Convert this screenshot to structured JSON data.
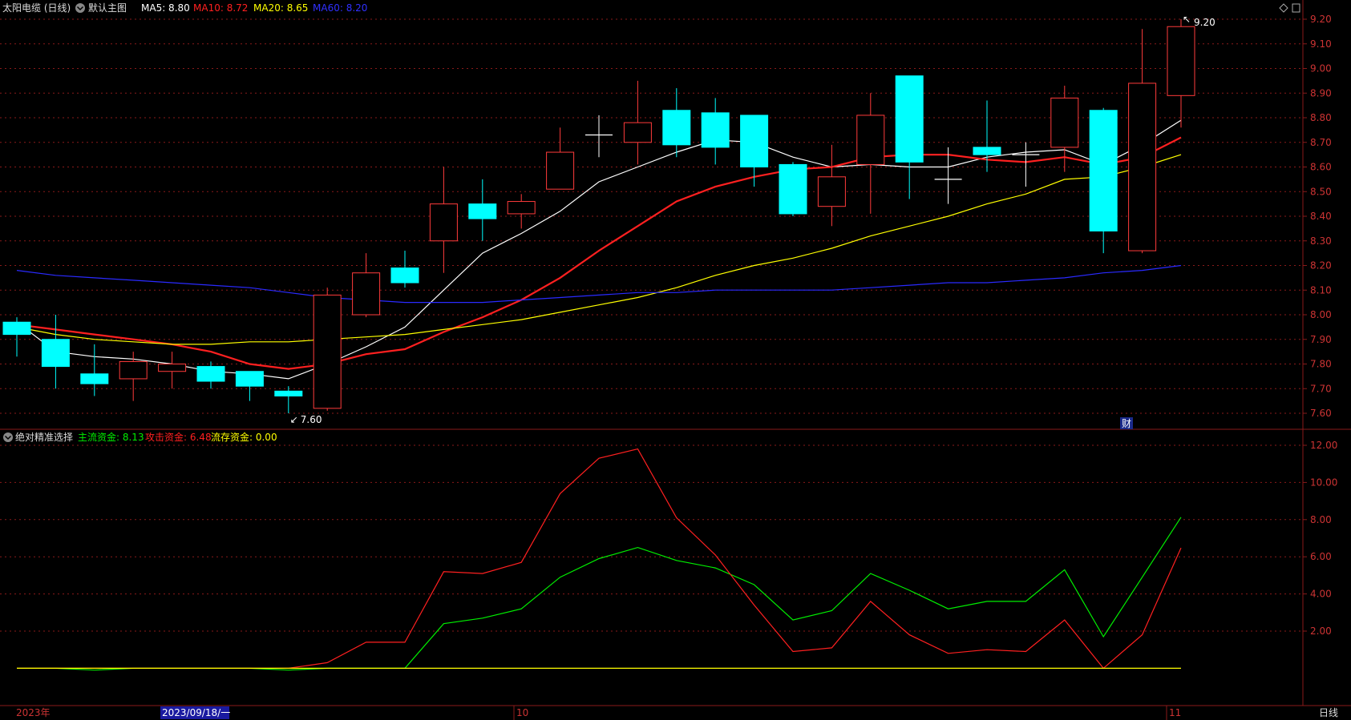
{
  "header": {
    "stock_title": "太阳电缆 (日线)",
    "indicator_dropdown": "默认主图",
    "ma5_label": "MA5: 8.80",
    "ma10_label": "MA10: 8.72",
    "ma20_label": "MA20: 8.65",
    "ma60_label": "MA60: 8.20"
  },
  "lower_header": {
    "indicator_name": "绝对精准选择",
    "main_fund_label": "主流资金: 8.13",
    "attack_fund_label": "攻击资金: 6.48",
    "flow_fund_label": "流存资金: 0.00"
  },
  "annotations": {
    "high_marker": "9.20",
    "low_marker": "7.60",
    "finance_badge": "财"
  },
  "bottom_bar": {
    "year_label": "2023年",
    "cursor_date": "2023/09/18/一",
    "month_oct": "10",
    "month_nov": "11",
    "period_label": "日线"
  },
  "colors": {
    "up": "#ff3b3b",
    "down": "#00ffff",
    "ma5": "#ffffff",
    "ma10": "#ff2020",
    "ma20": "#ffff00",
    "ma60": "#2a2aff",
    "main_fund": "#00ee00",
    "attack_fund": "#ff2020",
    "flow_fund": "#ffff00",
    "grid": "#8a1a1a"
  },
  "chart_data": [
    {
      "type": "candlestick",
      "ylim": [
        7.55,
        9.25
      ],
      "yticks": [
        "9.20",
        "9.10",
        "9.00",
        "8.90",
        "8.80",
        "8.70",
        "8.60",
        "8.50",
        "8.40",
        "8.30",
        "8.20",
        "8.10",
        "8.00",
        "7.90",
        "7.80",
        "7.70",
        "7.60"
      ],
      "candles": [
        {
          "o": 7.97,
          "c": 7.92,
          "h": 7.99,
          "l": 7.83
        },
        {
          "o": 7.9,
          "c": 7.79,
          "h": 8.0,
          "l": 7.7
        },
        {
          "o": 7.76,
          "c": 7.72,
          "h": 7.88,
          "l": 7.67
        },
        {
          "o": 7.74,
          "c": 7.81,
          "h": 7.85,
          "l": 7.65
        },
        {
          "o": 7.77,
          "c": 7.8,
          "h": 7.85,
          "l": 7.7
        },
        {
          "o": 7.79,
          "c": 7.73,
          "h": 7.81,
          "l": 7.7
        },
        {
          "o": 7.77,
          "c": 7.71,
          "h": 7.77,
          "l": 7.65
        },
        {
          "o": 7.69,
          "c": 7.67,
          "h": 7.71,
          "l": 7.6
        },
        {
          "o": 7.62,
          "c": 8.08,
          "h": 8.11,
          "l": 7.61
        },
        {
          "o": 8.0,
          "c": 8.17,
          "h": 8.25,
          "l": 7.99
        },
        {
          "o": 8.19,
          "c": 8.13,
          "h": 8.26,
          "l": 8.11
        },
        {
          "o": 8.3,
          "c": 8.45,
          "h": 8.6,
          "l": 8.17
        },
        {
          "o": 8.45,
          "c": 8.39,
          "h": 8.55,
          "l": 8.3
        },
        {
          "o": 8.41,
          "c": 8.46,
          "h": 8.49,
          "l": 8.35
        },
        {
          "o": 8.51,
          "c": 8.66,
          "h": 8.76,
          "l": 8.51
        },
        {
          "o": 8.73,
          "c": 8.73,
          "h": 8.81,
          "l": 8.64
        },
        {
          "o": 8.7,
          "c": 8.78,
          "h": 8.95,
          "l": 8.61
        },
        {
          "o": 8.83,
          "c": 8.69,
          "h": 8.92,
          "l": 8.64
        },
        {
          "o": 8.82,
          "c": 8.68,
          "h": 8.88,
          "l": 8.61
        },
        {
          "o": 8.81,
          "c": 8.6,
          "h": 8.81,
          "l": 8.52
        },
        {
          "o": 8.61,
          "c": 8.41,
          "h": 8.62,
          "l": 8.4
        },
        {
          "o": 8.44,
          "c": 8.56,
          "h": 8.69,
          "l": 8.36
        },
        {
          "o": 8.61,
          "c": 8.81,
          "h": 8.9,
          "l": 8.41
        },
        {
          "o": 8.97,
          "c": 8.62,
          "h": 8.97,
          "l": 8.47
        },
        {
          "o": 8.55,
          "c": 8.55,
          "h": 8.68,
          "l": 8.45
        },
        {
          "o": 8.68,
          "c": 8.65,
          "h": 8.87,
          "l": 8.58
        },
        {
          "o": 8.65,
          "c": 8.65,
          "h": 8.7,
          "l": 8.52
        },
        {
          "o": 8.68,
          "c": 8.88,
          "h": 8.93,
          "l": 8.58
        },
        {
          "o": 8.83,
          "c": 8.34,
          "h": 8.84,
          "l": 8.25
        },
        {
          "o": 8.26,
          "c": 8.94,
          "h": 9.16,
          "l": 8.25
        },
        {
          "o": 8.89,
          "c": 9.17,
          "h": 9.2,
          "l": 8.76
        }
      ],
      "series": [
        {
          "name": "MA5",
          "values": [
            7.97,
            7.85,
            7.83,
            7.82,
            7.8,
            7.77,
            7.76,
            7.74,
            7.8,
            7.87,
            7.95,
            8.1,
            8.25,
            8.33,
            8.42,
            8.54,
            8.6,
            8.66,
            8.71,
            8.7,
            8.64,
            8.6,
            8.61,
            8.6,
            8.6,
            8.64,
            8.66,
            8.67,
            8.61,
            8.69,
            8.79
          ]
        },
        {
          "name": "MA10",
          "values": [
            7.96,
            7.94,
            7.92,
            7.9,
            7.88,
            7.85,
            7.8,
            7.78,
            7.8,
            7.84,
            7.86,
            7.93,
            7.99,
            8.06,
            8.15,
            8.26,
            8.36,
            8.46,
            8.52,
            8.56,
            8.59,
            8.6,
            8.64,
            8.65,
            8.65,
            8.63,
            8.62,
            8.64,
            8.61,
            8.64,
            8.72
          ]
        },
        {
          "name": "MA20",
          "values": [
            7.95,
            7.92,
            7.9,
            7.89,
            7.88,
            7.88,
            7.89,
            7.89,
            7.9,
            7.91,
            7.92,
            7.94,
            7.96,
            7.98,
            8.01,
            8.04,
            8.07,
            8.11,
            8.16,
            8.2,
            8.23,
            8.27,
            8.32,
            8.36,
            8.4,
            8.45,
            8.49,
            8.55,
            8.56,
            8.6,
            8.65
          ]
        },
        {
          "name": "MA60",
          "values": [
            8.18,
            8.16,
            8.15,
            8.14,
            8.13,
            8.12,
            8.11,
            8.09,
            8.07,
            8.06,
            8.05,
            8.05,
            8.05,
            8.06,
            8.07,
            8.08,
            8.09,
            8.09,
            8.1,
            8.1,
            8.1,
            8.1,
            8.11,
            8.12,
            8.13,
            8.13,
            8.14,
            8.15,
            8.17,
            8.18,
            8.2
          ]
        }
      ]
    },
    {
      "type": "line",
      "ylim": [
        0,
        12.4
      ],
      "yticks": [
        "12.00",
        "10.00",
        "8.00",
        "6.00",
        "4.00",
        "2.00"
      ],
      "series": [
        {
          "name": "主流资金",
          "values": [
            0.0,
            0.0,
            -0.1,
            0.0,
            0.0,
            0.0,
            0.0,
            -0.1,
            0.0,
            0.0,
            0.0,
            2.4,
            2.7,
            3.2,
            4.9,
            5.9,
            6.5,
            5.8,
            5.4,
            4.5,
            2.6,
            3.1,
            5.1,
            4.2,
            3.2,
            3.6,
            3.6,
            5.3,
            1.7,
            4.9,
            8.13
          ]
        },
        {
          "name": "攻击资金",
          "values": [
            0.0,
            0.0,
            0.0,
            0.0,
            0.0,
            0.0,
            0.0,
            0.0,
            0.3,
            1.4,
            1.4,
            5.2,
            5.1,
            5.7,
            9.4,
            11.3,
            11.8,
            8.1,
            6.1,
            3.4,
            0.9,
            1.1,
            3.6,
            1.8,
            0.8,
            1.0,
            0.9,
            2.6,
            0.0,
            1.8,
            6.48
          ]
        },
        {
          "name": "流存资金",
          "values": [
            0.0,
            0.0,
            0.0,
            0.0,
            0.0,
            0.0,
            0.0,
            0.0,
            0.0,
            0.0,
            0.0,
            0.0,
            0.0,
            0.0,
            0.0,
            0.0,
            0.0,
            0.0,
            0.0,
            0.0,
            0.0,
            0.0,
            0.0,
            0.0,
            0.0,
            0.0,
            0.0,
            0.0,
            0.0,
            0.0,
            0.0
          ]
        }
      ]
    }
  ]
}
